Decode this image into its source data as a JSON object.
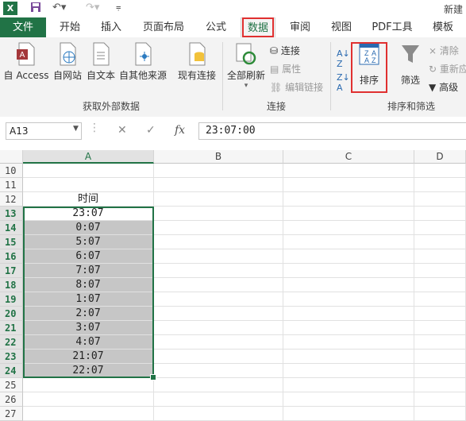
{
  "window": {
    "title": "新建"
  },
  "tabs": [
    "文件",
    "开始",
    "插入",
    "页面布局",
    "公式",
    "数据",
    "审阅",
    "视图",
    "PDF工具",
    "模板"
  ],
  "ribbon": {
    "get_external": {
      "buttons": [
        "自 Access",
        "自网站",
        "自文本",
        "自其他来源",
        "现有连接"
      ],
      "label": "获取外部数据"
    },
    "connections": {
      "refresh_all": "全部刷新",
      "items": [
        "连接",
        "属性",
        "编辑链接"
      ],
      "label": "连接"
    },
    "sort_filter": {
      "sort": "排序",
      "filter": "筛选",
      "items": [
        "清除",
        "重新应用",
        "高级"
      ],
      "label": "排序和筛选"
    }
  },
  "formula_bar": {
    "name_box": "A13",
    "fx": "fx",
    "value": "23:07:00"
  },
  "grid": {
    "columns": [
      "A",
      "B",
      "C",
      "D"
    ],
    "rows": [
      {
        "num": "10",
        "a": ""
      },
      {
        "num": "11",
        "a": ""
      },
      {
        "num": "12",
        "a": "时间"
      },
      {
        "num": "13",
        "a": "23:07"
      },
      {
        "num": "14",
        "a": "0:07"
      },
      {
        "num": "15",
        "a": "5:07"
      },
      {
        "num": "16",
        "a": "6:07"
      },
      {
        "num": "17",
        "a": "7:07"
      },
      {
        "num": "18",
        "a": "8:07"
      },
      {
        "num": "19",
        "a": "1:07"
      },
      {
        "num": "20",
        "a": "2:07"
      },
      {
        "num": "21",
        "a": "3:07"
      },
      {
        "num": "22",
        "a": "4:07"
      },
      {
        "num": "23",
        "a": "21:07"
      },
      {
        "num": "24",
        "a": "22:07"
      },
      {
        "num": "25",
        "a": ""
      },
      {
        "num": "26",
        "a": ""
      },
      {
        "num": "27",
        "a": ""
      }
    ]
  },
  "colors": {
    "accent": "#217346",
    "highlight": "#e03030",
    "selection": "#c6c6c6"
  }
}
